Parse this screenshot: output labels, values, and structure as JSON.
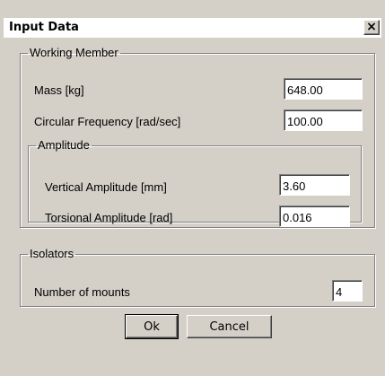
{
  "window": {
    "title": "Input Data",
    "close_glyph": "✕"
  },
  "working_member": {
    "legend": "Working Member",
    "mass_label": "Mass [kg]",
    "mass_value": "648.00",
    "freq_label": "Circular Frequency [rad/sec]",
    "freq_value": "100.00",
    "amplitude": {
      "legend": "Amplitude",
      "vertical_label": "Vertical Amplitude [mm]",
      "vertical_value": "3.60",
      "torsional_label": "Torsional Amplitude [rad]",
      "torsional_value": "0.016"
    }
  },
  "isolators": {
    "legend": "Isolators",
    "mounts_label": "Number of mounts",
    "mounts_value": "4"
  },
  "buttons": {
    "ok": "Ok",
    "cancel": "Cancel"
  },
  "colors": {
    "dialog_bg": "#d4d0c8",
    "titlebar_bg": "#ffffff"
  }
}
